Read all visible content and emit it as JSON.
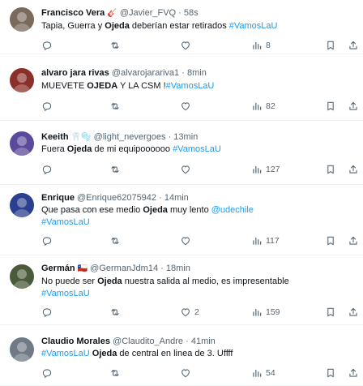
{
  "tweets": [
    {
      "name": "Francisco Vera",
      "emoji": "🎸",
      "handle": "@Javier_FVQ",
      "dot": "·",
      "time": "58s",
      "text": [
        {
          "t": "Tapia, Guerra y ",
          "s": ""
        },
        {
          "t": "Ojeda",
          "s": "bold"
        },
        {
          "t": " deberían estar retirados ",
          "s": ""
        },
        {
          "t": "#VamosLaU",
          "s": "tag"
        }
      ],
      "views": "8",
      "likes": "",
      "avatar_color": "#7a6a5c"
    },
    {
      "name": "alvaro jara rivas",
      "emoji": "",
      "handle": "@alvarojarariva1",
      "dot": "·",
      "time": "8min",
      "text": [
        {
          "t": "MUEVETE ",
          "s": ""
        },
        {
          "t": "OJEDA",
          "s": "bold"
        },
        {
          "t": " Y LA CSM !",
          "s": ""
        },
        {
          "t": "#VamosLaU",
          "s": "tag"
        }
      ],
      "views": "82",
      "likes": "",
      "avatar_color": "#8b2f2a"
    },
    {
      "name": "Keeith",
      "emoji": "🦷🫧",
      "handle": "@light_nevergoes",
      "dot": "·",
      "time": "13min",
      "text": [
        {
          "t": "Fuera ",
          "s": ""
        },
        {
          "t": "Ojeda",
          "s": "bold"
        },
        {
          "t": " de mi equipoooooo ",
          "s": ""
        },
        {
          "t": "#VamosLaU",
          "s": "tag"
        }
      ],
      "views": "127",
      "likes": "",
      "avatar_color": "#5b4a9b"
    },
    {
      "name": "Enrique",
      "emoji": "",
      "handle": "@Enrique62075942",
      "dot": "·",
      "time": "14min",
      "text": [
        {
          "t": "Que pasa con ese medio ",
          "s": ""
        },
        {
          "t": "Ojeda",
          "s": "bold"
        },
        {
          "t": " muy lento ",
          "s": ""
        },
        {
          "t": "@udechile",
          "s": "mention"
        },
        {
          "t": "\n",
          "s": "br"
        },
        {
          "t": "#VamosLaU",
          "s": "tag"
        }
      ],
      "views": "117",
      "likes": "",
      "avatar_color": "#2a3f8f"
    },
    {
      "name": "Germán",
      "emoji": "🇨🇱",
      "handle": "@GermanJdm14",
      "dot": "·",
      "time": "18min",
      "text": [
        {
          "t": "No puede ser ",
          "s": ""
        },
        {
          "t": "Ojeda",
          "s": "bold"
        },
        {
          "t": " nuestra salida al medio, es impresentable",
          "s": ""
        },
        {
          "t": "\n",
          "s": "br"
        },
        {
          "t": "#VamosLaU",
          "s": "tag"
        }
      ],
      "views": "159",
      "likes": "2",
      "avatar_color": "#4a5a3a"
    },
    {
      "name": "Claudio Morales",
      "emoji": "",
      "handle": "@Claudito_Andre",
      "dot": "·",
      "time": "41min",
      "text": [
        {
          "t": "#VamosLaU",
          "s": "tag"
        },
        {
          "t": " ",
          "s": ""
        },
        {
          "t": "Ojeda",
          "s": "bold"
        },
        {
          "t": " de central en linea de 3. Uffff",
          "s": ""
        }
      ],
      "views": "54",
      "likes": "",
      "avatar_color": "#6f7a86"
    }
  ],
  "icons": {
    "reply": "reply-icon",
    "retweet": "retweet-icon",
    "like": "like-icon",
    "views": "views-icon",
    "bookmark": "bookmark-icon",
    "share": "share-icon"
  }
}
